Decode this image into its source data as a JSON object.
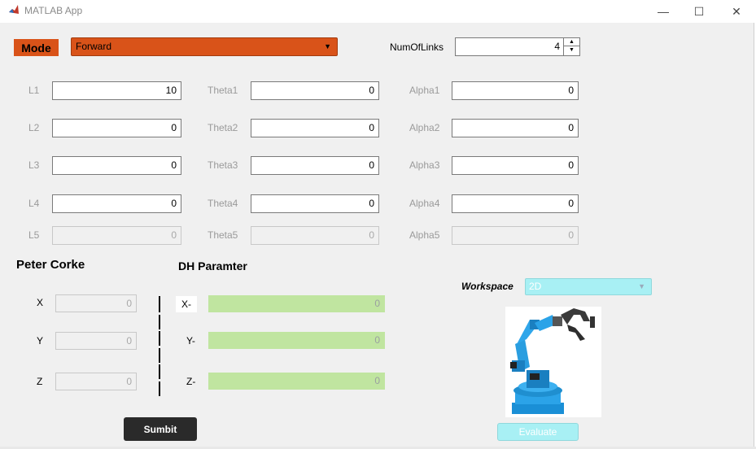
{
  "window": {
    "title": "MATLAB App",
    "minimize_glyph": "—",
    "maximize_glyph": "☐",
    "close_glyph": "✕"
  },
  "mode": {
    "label": "Mode",
    "selected": "Forward"
  },
  "num_links": {
    "label": "NumOfLinks",
    "value": "4"
  },
  "rows": [
    {
      "l_label": "L1",
      "l_value": "10",
      "theta_label": "Theta1",
      "theta_value": "0",
      "alpha_label": "Alpha1",
      "alpha_value": "0"
    },
    {
      "l_label": "L2",
      "l_value": "0",
      "theta_label": "Theta2",
      "theta_value": "0",
      "alpha_label": "Alpha2",
      "alpha_value": "0"
    },
    {
      "l_label": "L3",
      "l_value": "0",
      "theta_label": "Theta3",
      "theta_value": "0",
      "alpha_label": "Alpha3",
      "alpha_value": "0"
    },
    {
      "l_label": "L4",
      "l_value": "0",
      "theta_label": "Theta4",
      "theta_value": "0",
      "alpha_label": "Alpha4",
      "alpha_value": "0"
    },
    {
      "l_label": "L5",
      "l_value": "0",
      "theta_label": "Theta5",
      "theta_value": "0",
      "alpha_label": "Alpha5",
      "alpha_value": "0"
    }
  ],
  "peter_corke": {
    "heading": "Peter Corke",
    "x_label": "X",
    "x_value": "0",
    "y_label": "Y",
    "y_value": "0",
    "z_label": "Z",
    "z_value": "0"
  },
  "dh": {
    "heading": "DH Paramter",
    "x_label": "X-",
    "x_value": "0",
    "y_label": "Y-",
    "y_value": "0",
    "z_label": "Z-",
    "z_value": "0"
  },
  "workspace": {
    "label": "Workspace",
    "selected": "2D"
  },
  "buttons": {
    "evaluate": "Evaluate",
    "submit": "Sumbit"
  },
  "colors": {
    "mode_accent": "#d95319",
    "dh_output_fill": "#c0e5a0",
    "workspace_fill": "#a8f0f4",
    "submit_fill": "#2a2a2a"
  }
}
